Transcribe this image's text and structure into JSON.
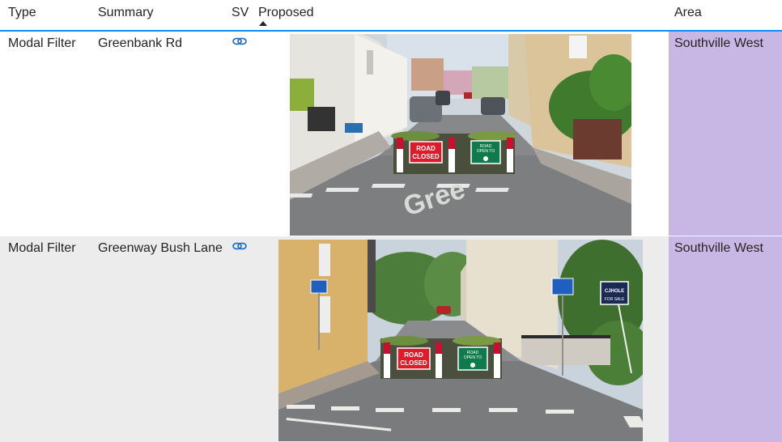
{
  "table": {
    "headers": {
      "type": "Type",
      "summary": "Summary",
      "sv": "SV",
      "proposed": "Proposed",
      "area": "Area"
    },
    "sort": {
      "column": "Proposed",
      "direction": "ascending"
    },
    "rows": [
      {
        "type": "Modal Filter",
        "summary": "Greenbank Rd",
        "area": "Southville West",
        "sign_closed_1": "ROAD",
        "sign_closed_2": "CLOSED",
        "sign_open_1": "ROAD",
        "sign_open_2": "OPEN TO",
        "road_marking": "Gree"
      },
      {
        "type": "Modal Filter",
        "summary": "Greenway Bush Lane",
        "area": "Southville West",
        "sign_closed_1": "ROAD",
        "sign_closed_2": "CLOSED",
        "sign_open_1": "ROAD",
        "sign_open_2": "OPEN TO",
        "estate_sign_1": "CJHOLE",
        "estate_sign_2": "FOR SALE"
      }
    ]
  },
  "colors": {
    "header_underline": "#118dff",
    "area_fill": "#c8b6e4",
    "row_alt": "#ececec",
    "link_icon": "#1f6fc5"
  }
}
